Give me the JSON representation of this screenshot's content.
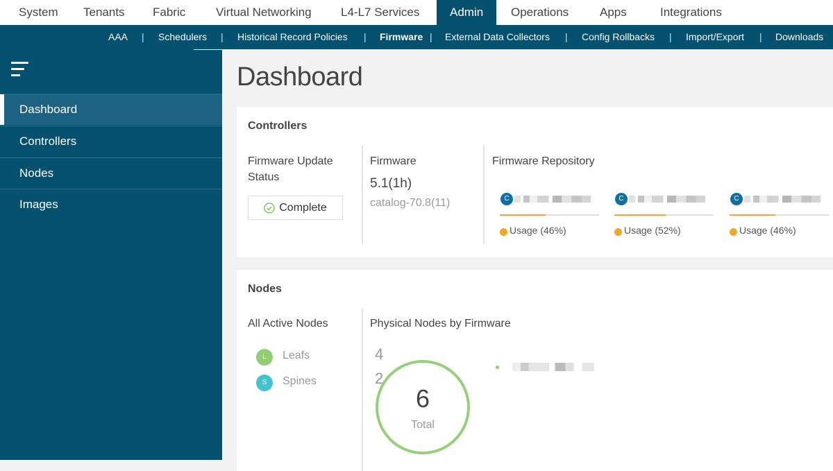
{
  "top_nav": {
    "tabs": [
      {
        "label": "System"
      },
      {
        "label": "Tenants"
      },
      {
        "label": "Fabric"
      },
      {
        "label": "Virtual Networking"
      },
      {
        "label": "L4-L7 Services"
      },
      {
        "label": "Admin",
        "active": true
      },
      {
        "label": "Operations"
      },
      {
        "label": "Apps"
      },
      {
        "label": "Integrations"
      }
    ]
  },
  "sub_nav": {
    "items": [
      {
        "label": "AAA"
      },
      {
        "label": "Schedulers"
      },
      {
        "label": "Historical Record Policies"
      },
      {
        "label": "Firmware",
        "active": true
      },
      {
        "label": "External Data Collectors"
      },
      {
        "label": "Config Rollbacks"
      },
      {
        "label": "Import/Export"
      },
      {
        "label": "Downloads"
      }
    ],
    "separator": "|"
  },
  "sidebar": {
    "menu_icon": "hamburger-menu-icon",
    "items": [
      {
        "label": "Dashboard",
        "active": true
      },
      {
        "label": "Controllers"
      },
      {
        "label": "Nodes"
      },
      {
        "label": "Images"
      }
    ]
  },
  "page": {
    "title": "Dashboard"
  },
  "controllers": {
    "title": "Controllers",
    "update_status_label": "Firmware Update Status",
    "update_status_value": "Complete",
    "update_status_icon": "check-circle-icon",
    "firmware_label": "Firmware",
    "firmware_version": "5.1(1h)",
    "firmware_catalog": "catalog-70.8(11)",
    "repository_label": "Firmware Repository",
    "repositories": [
      {
        "badge": "C",
        "usage_label": "Usage (46%)",
        "usage_percent": 46
      },
      {
        "badge": "C",
        "usage_label": "Usage (52%)",
        "usage_percent": 52
      },
      {
        "badge": "C",
        "usage_label": "Usage (46%)",
        "usage_percent": 46
      }
    ]
  },
  "nodes": {
    "title": "Nodes",
    "active_label": "All Active Nodes",
    "legend": [
      {
        "badge": "L",
        "label": "Leafs",
        "color": "#8fce72"
      },
      {
        "badge": "S",
        "label": "Spines",
        "color": "#45c2d0"
      }
    ],
    "by_firmware_label": "Physical Nodes by Firmware",
    "leaf_count": "4",
    "spine_count": "2",
    "total": "6",
    "total_label": "Total",
    "ring_color": "#97d07b"
  },
  "colors": {
    "brand": "#04506f",
    "usage_accent": "#f5a623",
    "badge_blue": "#0d6fa6"
  }
}
